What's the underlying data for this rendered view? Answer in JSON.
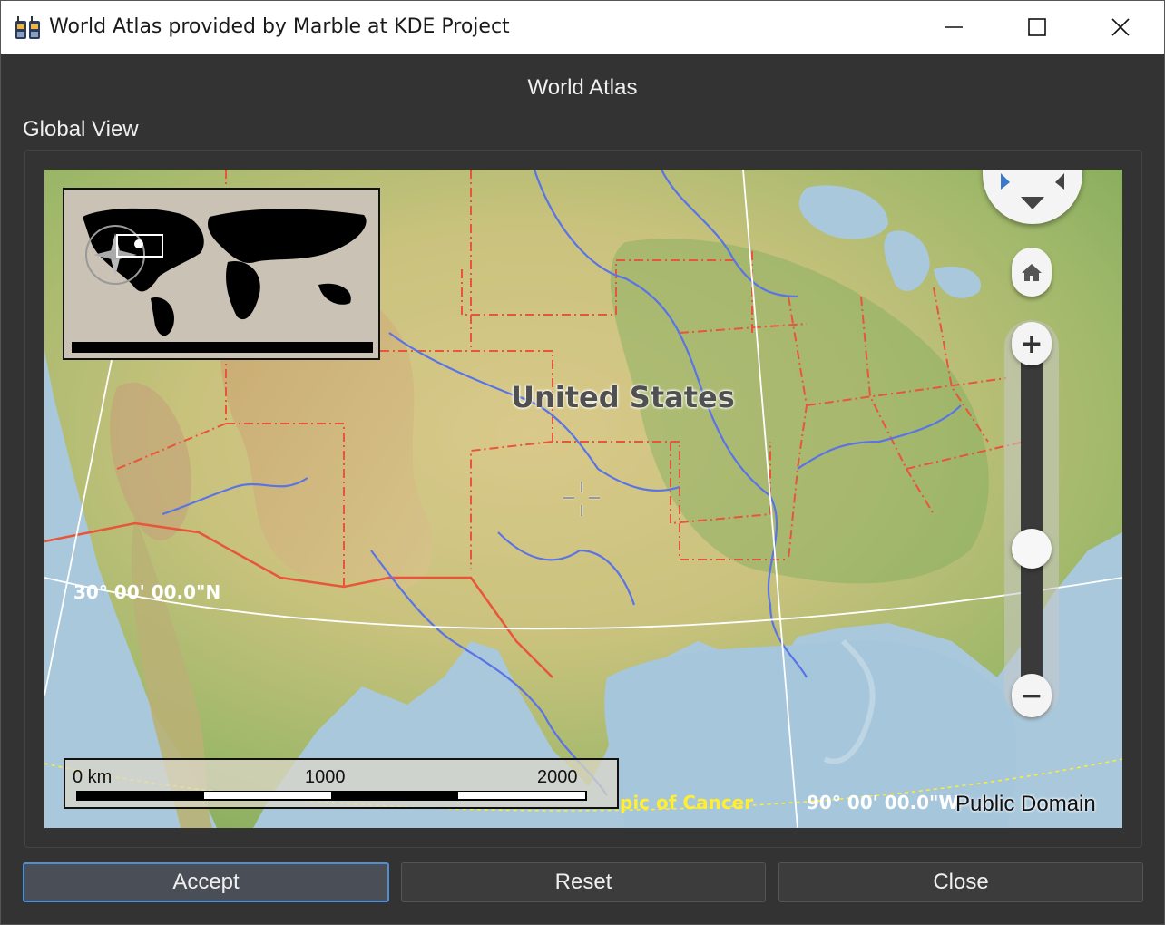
{
  "window": {
    "title": "World Atlas provided by Marble at KDE Project",
    "controls": [
      "minimize",
      "maximize",
      "close"
    ]
  },
  "heading": "World Atlas",
  "group_label": "Global View",
  "map": {
    "country_label": "United States",
    "latitude_label": "30° 00' 00.0\"N",
    "longitude_label": "90° 00' 00.0\"W",
    "tropic_label": "pic of Cancer",
    "attribution": "Public Domain",
    "scale": {
      "start": "0 km",
      "mid": "1000",
      "end": "2000"
    },
    "controls": {
      "navigation": "compass-navigation",
      "home": "home-icon",
      "zoom_in": "+",
      "zoom_out": "−",
      "zoom_level": 0.5
    },
    "colors": {
      "border_state": "#e8553a",
      "river": "#5a73e6",
      "grid": "#ffffff",
      "tropic": "#ffee33"
    }
  },
  "buttons": {
    "accept": "Accept",
    "reset": "Reset",
    "close": "Close"
  }
}
